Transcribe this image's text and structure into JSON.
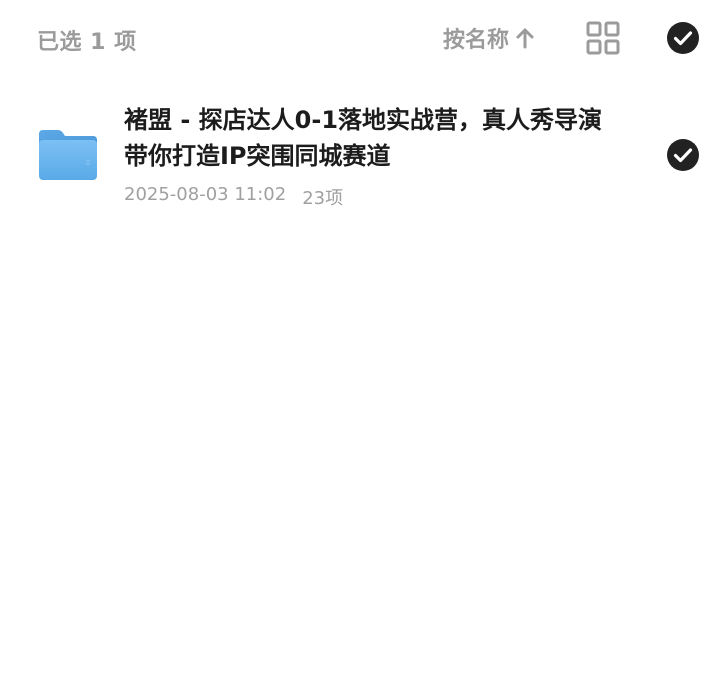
{
  "topbar": {
    "selected_count": "已选 1 项",
    "sort_label": "按名称",
    "sort_direction_icon": "arrow-up-icon",
    "view_toggle_icon": "grid-view-icon",
    "select_all_icon": "check-circle-icon",
    "select_all_checked": true
  },
  "files": [
    {
      "type": "folder",
      "icon": "folder-icon",
      "name": "褚盟 - 探店达人0-1落地实战营，真人秀导演带你打造IP突围同城赛道",
      "modified": "2025-08-03 11:02",
      "item_count": "23项",
      "selected": true
    }
  ],
  "colors": {
    "muted_text": "#9b9b9b",
    "title_text": "#1c1c1c",
    "meta_text": "#a0a0a0",
    "check_fill": "#222222",
    "folder_blue": "#6cb6f0"
  }
}
